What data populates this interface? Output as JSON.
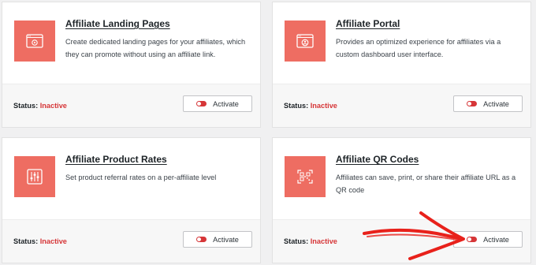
{
  "status_label": "Status:",
  "activate_label": "Activate",
  "icon_bg_color": "#ee6d62",
  "inactive_color": "#d63638",
  "annotation_color": "#e8211b",
  "addons": [
    {
      "title": "Affiliate Landing Pages",
      "description": "Create dedicated landing pages for your affiliates, which they can promote without using an affiliate link.",
      "status": "Inactive",
      "icon": "landing-page-icon"
    },
    {
      "title": "Affiliate Portal",
      "description": "Provides an optimized experience for affiliates via a custom dashboard user interface.",
      "status": "Inactive",
      "icon": "portal-icon"
    },
    {
      "title": "Affiliate Product Rates",
      "description": "Set product referral rates on a per-affiliate level",
      "status": "Inactive",
      "icon": "sliders-icon"
    },
    {
      "title": "Affiliate QR Codes",
      "description": "Affiliates can save, print, or share their affiliate URL as a QR code",
      "status": "Inactive",
      "icon": "qr-code-icon"
    }
  ]
}
